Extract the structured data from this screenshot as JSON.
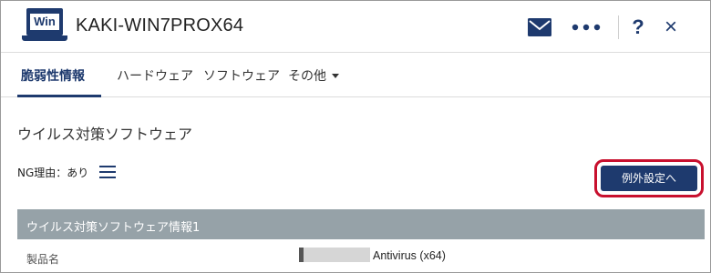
{
  "header": {
    "logo_label": "Win",
    "hostname": "KAKI-WIN7PROX64",
    "help_label": "?",
    "close_label": "×"
  },
  "tabs": [
    {
      "label": "脆弱性情報",
      "active": true
    },
    {
      "label": "ハードウェア",
      "active": false
    },
    {
      "label": "ソフトウェア",
      "active": false
    },
    {
      "label": "その他",
      "active": false
    }
  ],
  "section": {
    "title": "ウイルス対策ソフトウェア",
    "ng_reason": "NG理由：あり",
    "exception_button": "例外設定へ"
  },
  "table": {
    "group_title": "ウイルス対策ソフトウェア情報1",
    "rows": [
      {
        "label": "製品名",
        "value": "Antivirus (x64)"
      }
    ]
  },
  "colors": {
    "brand": "#1e3a6e",
    "band": "#96a2a8",
    "highlight": "#c8102e"
  },
  "icons": [
    "laptop-icon",
    "mail-icon",
    "more-icon",
    "menu-icon",
    "chevron-down-icon"
  ]
}
